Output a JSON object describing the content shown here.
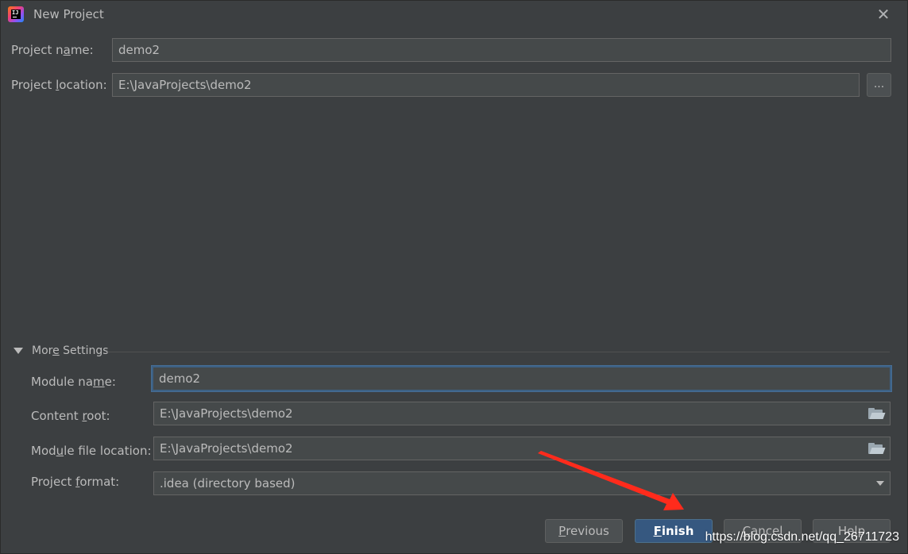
{
  "window": {
    "title": "New Project",
    "app_icon_text": "IJ",
    "close_glyph": "✕"
  },
  "project": {
    "name_label_pre": "Project n",
    "name_label_mn": "a",
    "name_label_post": "me:",
    "name_value": "demo2",
    "location_label_pre": "Project ",
    "location_label_mn": "l",
    "location_label_post": "ocation:",
    "location_value": "E:\\JavaProjects\\demo2",
    "browse_label": "..."
  },
  "more_settings": {
    "header_pre": "Mor",
    "header_mn": "e",
    "header_post": " Settings",
    "expanded": true,
    "module_name_label_pre": "Module na",
    "module_name_label_mn": "m",
    "module_name_label_post": "e:",
    "module_name_value": "demo2",
    "content_root_label_pre": "Content ",
    "content_root_label_mn": "r",
    "content_root_label_post": "oot:",
    "content_root_value": "E:\\JavaProjects\\demo2",
    "module_file_label_pre": "Mod",
    "module_file_label_mn": "u",
    "module_file_label_post": "le file location:",
    "module_file_value": "E:\\JavaProjects\\demo2",
    "format_label_pre": "Project ",
    "format_label_mn": "f",
    "format_label_post": "ormat:",
    "format_value": ".idea (directory based)"
  },
  "buttons": {
    "previous_mn": "P",
    "previous_rest": "revious",
    "finish_mn": "F",
    "finish_rest": "inish",
    "cancel_pre": "",
    "cancel_mn": "C",
    "cancel_rest": "ancel",
    "help_pre": "He",
    "help_mn": "l",
    "help_rest": "p"
  },
  "annotation": {
    "arrow_color": "#ff2b1c"
  },
  "watermark": "https://blog.csdn.net/qq_26711723",
  "colors": {
    "background": "#3c3f41",
    "field_bg": "#45494a",
    "primary_button": "#365880",
    "focus_border": "#3d6185"
  }
}
